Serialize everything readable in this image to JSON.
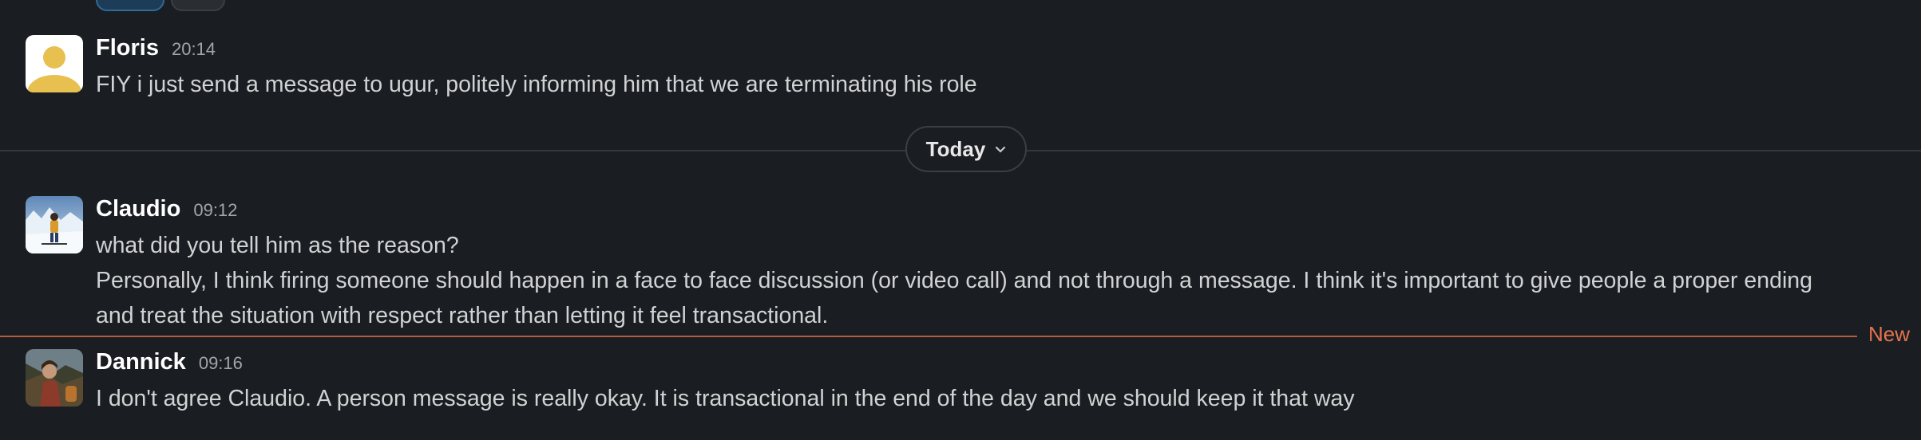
{
  "colors": {
    "background": "#1a1d21",
    "new_divider": "#b55a3c",
    "new_label": "#e3734f"
  },
  "messages": [
    {
      "author": "Floris",
      "time": "20:14",
      "lines": [
        "FIY i just send a message to ugur, politely informing him that we are terminating his role"
      ]
    },
    {
      "author": "Claudio",
      "time": "09:12",
      "lines": [
        "what did you tell him as the reason?",
        "Personally, I think firing someone should happen in a face to face discussion (or video call) and not through a message. I think it's important to give people a proper ending",
        "and treat the situation with respect rather than letting it feel transactional."
      ]
    },
    {
      "author": "Dannick",
      "time": "09:16",
      "lines": [
        "I don't agree Claudio. A person message is really okay. It is transactional in the end of the day and we should keep it that way"
      ]
    }
  ],
  "day_divider": {
    "label": "Today",
    "icon": "chevron-down-icon"
  },
  "new_divider": {
    "label": "New"
  }
}
